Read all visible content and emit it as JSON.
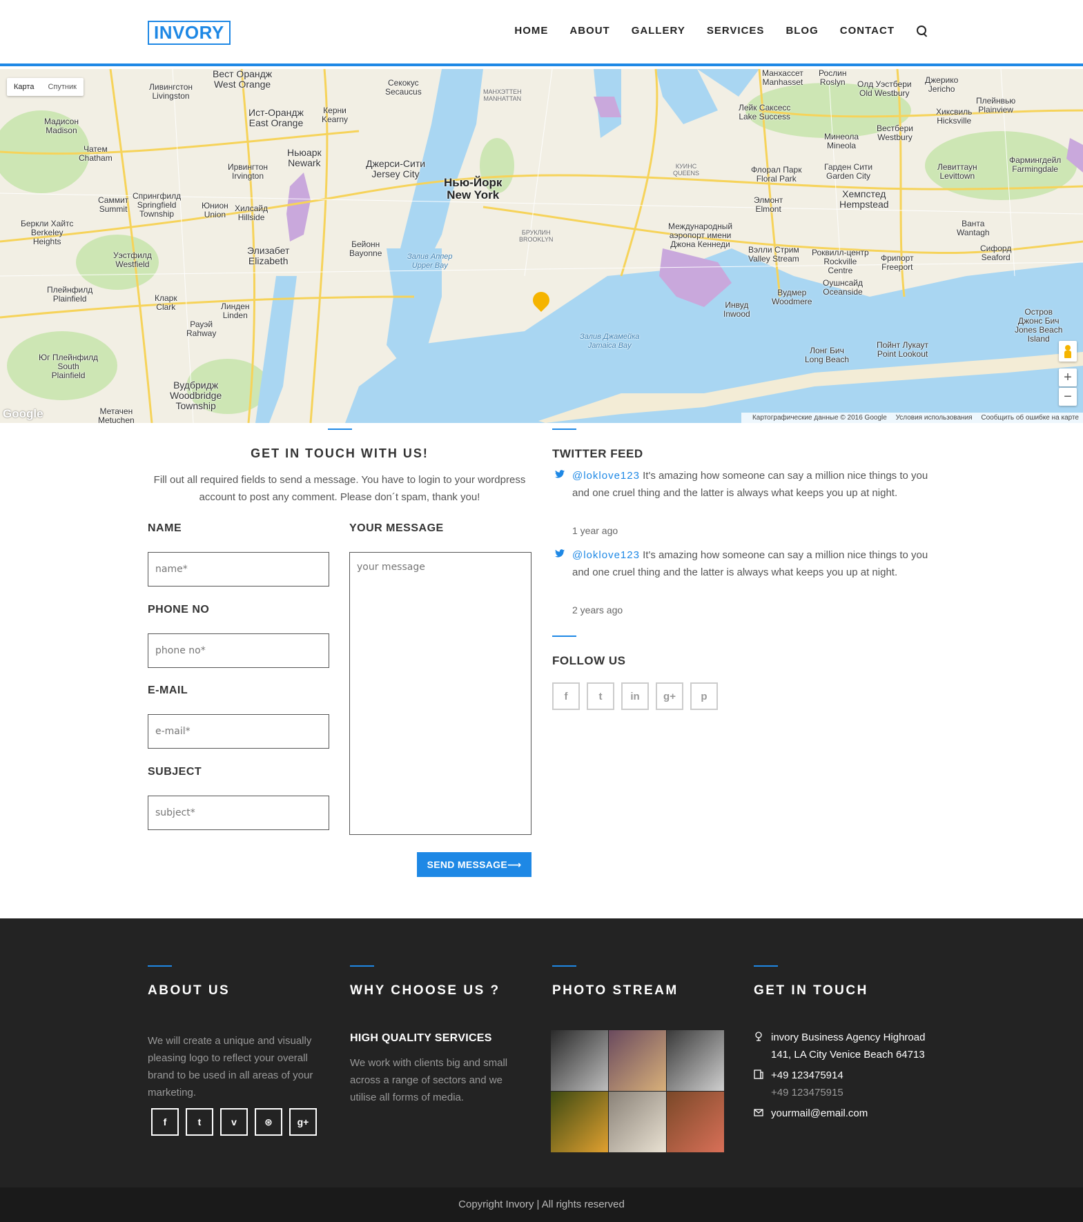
{
  "brand": {
    "logo": "INVORY",
    "accent": "#1e88e5"
  },
  "nav": {
    "items": [
      "HOME",
      "ABOUT",
      "GALLERY",
      "SERVICES",
      "BLOG",
      "CONTACT"
    ]
  },
  "map": {
    "toggle": [
      "Карта",
      "Спутник"
    ],
    "zoom_in": "+",
    "zoom_out": "−",
    "google": "Google",
    "attribution": [
      "Картографические данные © 2016 Google",
      "Условия использования",
      "Сообщить об ошибке на карте"
    ],
    "labels": {
      "ny": "Нью-Йорк\nNew York",
      "jersey": "Джерси-Сити\nJersey City",
      "newark": "Ньюарк\nNewark",
      "brooklyn": "БРУКЛИН\nBROOKLYN",
      "queens": "КУИНС\nQUEENS",
      "jfk": "Международный\nаэропорт имени\nДжона Кеннеди",
      "hempstead": "Хемпстед\nHempstead",
      "elizabeth": "Элизабет\nElizabeth",
      "bayonne": "Бейонн\nBayonne",
      "upper_bay": "Залив Аппер\nUpper Bay",
      "jamaica_bay": "Залив Джамейка\nJamaica Bay",
      "plainfield": "Плейнфилд\nPlainfield",
      "rahway": "Рауэй\nRahway",
      "west_orange": "Вест Орандж\nWest Orange",
      "east_orange": "Ист-Орандж\nEast Orange",
      "levittown": "Левиттаун\nLevittown",
      "long_beach": "Лонг Бич\nLong Beach",
      "freeport": "Фрипорт\nFreeport",
      "woodbridge": "Вудбридж\nWoodbridge\nTownship",
      "manhattan": "МАНХЭТТЕН\nMANHATTAN",
      "summit": "Саммит\nSummit",
      "union": "Юнион\nUnion",
      "linden": "Линден\nLinden",
      "irvington": "Ирвингтон\nIrvington",
      "madison": "Мадисон\nMadison",
      "chatham": "Чатем\nChatham",
      "westfield": "Уэстфилд\nWestfield",
      "clark": "Кларк\nClark",
      "floral_park": "Флорал Парк\nFloral Park",
      "garden_city": "Гарден Сити\nGarden City",
      "hicksville": "Хиксвиль\nHicksville",
      "elmont": "Элмонт\nElmont",
      "valley_stream": "Вэлли Стрим\nValley Stream",
      "oceanside": "Оушнсайд\nOceanside",
      "rockville": "Роквилл-центр\nRockville\nCentre",
      "inwood": "Инвуд\nInwood",
      "woodmere": "Вудмер\nWoodmere",
      "lake_success": "Лейк Саксесс\nLake Success",
      "westbury": "Вестбери\nWestbury",
      "mineola": "Минеола\nMineola",
      "seaford": "Сифорд\nSeaford",
      "wantagh": "Ванта\nWantagh",
      "point_lookout": "Пойнт Лукаут\nPoint Lookout",
      "jones_beach": "Остров\nДжонс Бич\nJones Beach\nIsland",
      "secaucus": "Секокус\nSecaucus",
      "kearny": "Керни\nKearny",
      "livingston": "Ливингстон\nLivingston",
      "south_plainfield": "Юг Плейнфилд\nSouth\nPlainfield",
      "berkeley": "Беркли Хайтс\nBerkeley\nHeights",
      "springfield": "Спрингфилд\nSpringfield\nTownship",
      "hillside": "Хилсайд\nHillside",
      "metuchen": "Метачен\nMetuchen",
      "manhasset": "Манхассет\nManhasset",
      "roslyn": "Рослин\nRoslyn",
      "old_westbury": "Олд Уэстбери\nOld Westbury",
      "jericho": "Джерико\nJericho",
      "plainview": "Плейнвью\nPlainview",
      "farmingdale": "Фармингдейл\nFarmingdale"
    }
  },
  "contact_form": {
    "title": "GET IN TOUCH WITH US!",
    "intro": "Fill out all required fields to send a message. You have to login to your wordpress account to post any comment. Please don´t spam, thank you!",
    "name_label": "NAME",
    "name_placeholder": "name*",
    "phone_label": "PHONE NO",
    "phone_placeholder": "phone no*",
    "email_label": "E-MAIL",
    "email_placeholder": "e-mail*",
    "subject_label": "SUBJECT",
    "subject_placeholder": "subject*",
    "message_label": "YOUR MESSAGE",
    "message_placeholder": "your message",
    "send_label": "SEND MESSAGE⟶"
  },
  "twitter": {
    "title": "TWITTER FEED",
    "tweets": [
      {
        "handle": "@loklove123",
        "text": " It's amazing how someone can say a million nice things to you and one cruel thing and the latter is always what keeps you up at night.",
        "time": "1 year ago"
      },
      {
        "handle": "@loklove123",
        "text": " It's amazing how someone can say a million nice things to you and one cruel thing and the latter is always what keeps you up at night.",
        "time": "2 years ago"
      }
    ]
  },
  "follow": {
    "title": "FOLLOW US",
    "icons": [
      {
        "name": "facebook-icon",
        "glyph": "f"
      },
      {
        "name": "twitter-icon",
        "glyph": "t"
      },
      {
        "name": "linkedin-icon",
        "glyph": "in"
      },
      {
        "name": "google-plus-icon",
        "glyph": "g+"
      },
      {
        "name": "pinterest-icon",
        "glyph": "p"
      }
    ]
  },
  "footer": {
    "about": {
      "title": "ABOUT US",
      "text": "We will create a unique and visually pleasing logo to reflect your overall brand to be used in all areas of your marketing.",
      "icons": [
        {
          "name": "facebook-icon",
          "glyph": "f"
        },
        {
          "name": "twitter-icon",
          "glyph": "t"
        },
        {
          "name": "vimeo-icon",
          "glyph": "v"
        },
        {
          "name": "dribbble-icon",
          "glyph": "⊛"
        },
        {
          "name": "google-plus-icon",
          "glyph": "g+"
        }
      ]
    },
    "why": {
      "title": "WHY CHOOSE US ?",
      "subtitle": "HIGH QUALITY SERVICES",
      "text": "We work with clients big and small across a range of sectors and we utilise all forms of media."
    },
    "photos": {
      "title": "PHOTO STREAM",
      "tiles": [
        {
          "name": "photo-corridor",
          "colors": [
            "#2a2a2a",
            "#bdbdbd"
          ]
        },
        {
          "name": "photo-bridge",
          "colors": [
            "#6a4a5e",
            "#d8b07a"
          ]
        },
        {
          "name": "photo-binoculars",
          "colors": [
            "#3a3a3a",
            "#cfcfcf"
          ]
        },
        {
          "name": "photo-park",
          "colors": [
            "#3d4a12",
            "#e0a030"
          ]
        },
        {
          "name": "photo-city",
          "colors": [
            "#8a8278",
            "#e9e1d2"
          ]
        },
        {
          "name": "photo-locks",
          "colors": [
            "#7a4828",
            "#d97058"
          ]
        }
      ]
    },
    "contact": {
      "title": "GET IN TOUCH",
      "address": "invory Business Agency Highroad 141, LA City Venice Beach 64713",
      "phone1": "+49 123475914",
      "phone2": "+49 123475915",
      "email": "yourmail@email.com"
    },
    "copyright": "Copyright Invory | All rights reserved"
  }
}
